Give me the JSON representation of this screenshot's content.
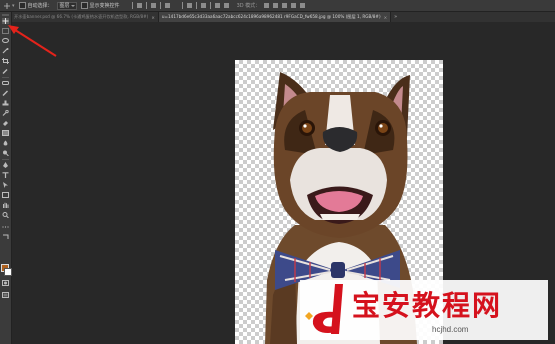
{
  "options_bar": {
    "auto_select_label": "自动选择：",
    "auto_select_value": "图层",
    "show_transform_label": "显示变换控件"
  },
  "tabs": [
    {
      "label": "开水壶banner.psd @ 66.7% (卡通鸡蛋热水壶开饮机造型款, RGB/8#)",
      "active": false
    },
    {
      "label": "u=1417bd6e65c3d33aa6aac72abcc624c1896a98962481 r9FGaCD_fw658.jpg @ 100% (图层 1, RGB/8#)",
      "active": true
    }
  ],
  "colors": {
    "foreground": "#b0621f",
    "background": "#ffffff",
    "annotation": "#e4231b"
  },
  "watermark": {
    "text": "宝安教程网",
    "url": "hcjhd.com"
  }
}
